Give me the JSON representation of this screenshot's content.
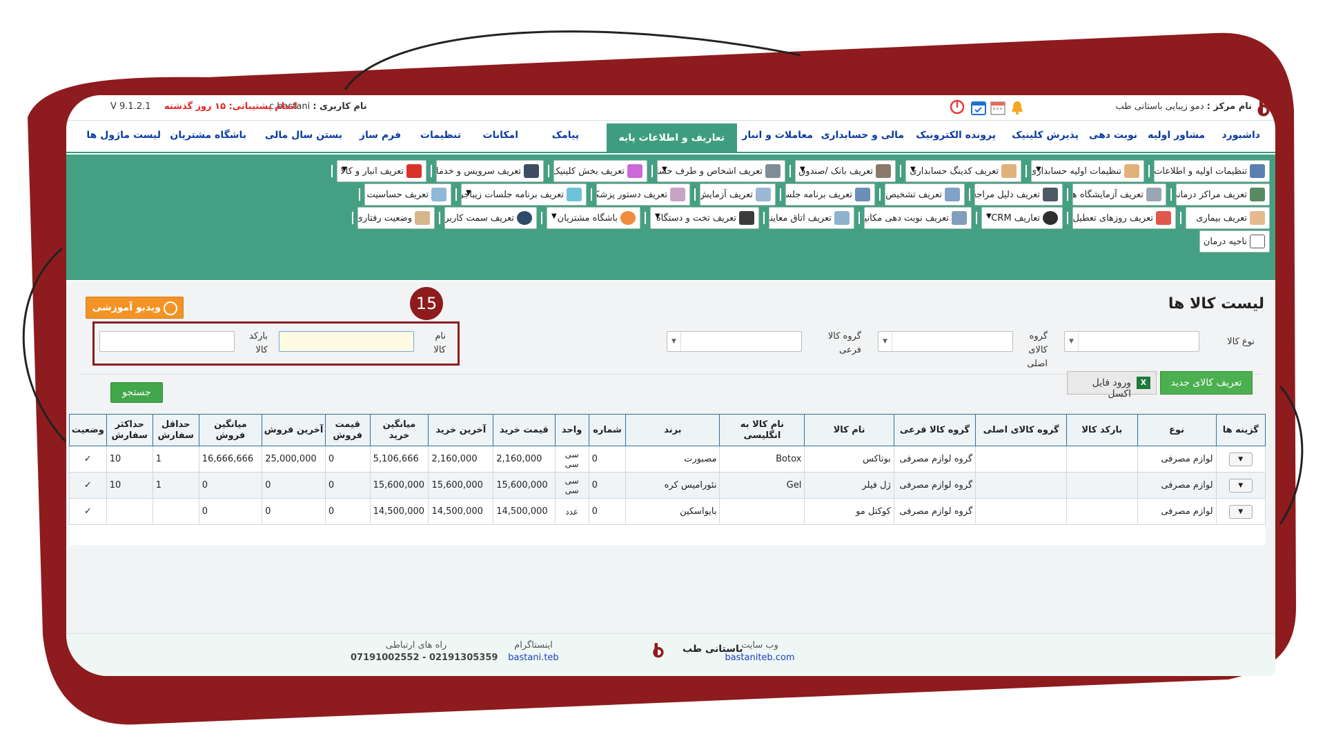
{
  "colors": {
    "frame": "#8e1b1e",
    "green_panel": "#45a083",
    "nav_link": "#0b3aa3",
    "accent_orange": "#f39325",
    "search_green": "#42a64b"
  },
  "topbar": {
    "center_label": "نام مرکز :",
    "center_name": "دمو زیبایی باستانی طب",
    "user_label": "نام کاربری :",
    "user_name": "c.bastani",
    "support": "اتمام پشتیبانی: ۱۵ روز گذشته",
    "version": "V 9.1.2.1",
    "icons": [
      "bell-icon",
      "calendar-icon",
      "calendar-check-icon",
      "power-icon"
    ]
  },
  "nav": {
    "items": [
      "داشبورد",
      "مشاور اولیه",
      "نوبت دهی",
      "پذیرش کلینیک",
      "پرونده الکترونیک",
      "مالی و حسابداری",
      "معاملات و انبار",
      "تعاریف و اطلاعات پایه",
      "پیامک",
      "امکانات",
      "تنظیمات",
      "فرم ساز",
      "بستن سال مالی",
      "باشگاه مشتریان",
      "لیست ماژول ها"
    ],
    "active": "تعاریف و اطلاعات پایه"
  },
  "submenu": {
    "row1": [
      "تنظیمات اولیه و اطلاعات مرکز",
      "تنظیمات اولیه حسابداری",
      "تعریف کدینگ حسابداری",
      "تعریف بانک /صندوق",
      "تعریف اشخاص و طرف حساب",
      "تعریف بخش کلینیک",
      "تعریف سرویس و خدمات",
      "تعریف انبار و کالا"
    ],
    "row2": [
      "تعریف مراکز درمانی",
      "تعریف آزمایشگاه ها",
      "تعریف دلیل مراجعه",
      "تعریف تشخیص",
      "تعریف برنامه جلسات",
      "تعریف آزمایش",
      "تعریف دستور پزشکی",
      "تعریف برنامه جلسات زیباجو",
      "تعریف حساسیت"
    ],
    "row3": [
      "تعریف بیماری",
      "تعریف روزهای تعطیل",
      "تعاریف CRM",
      "تعریف نوبت دهی مکانیزه",
      "تعریف اتاق معاینه",
      "تعریف تخت و دستگاه",
      "باشگاه مشتریان",
      "تعریف سمت کاربر",
      "وضعیت رفتاری"
    ],
    "row4": [
      "ناحیه درمان"
    ]
  },
  "page": {
    "title": "لیست کالا ها",
    "video_button": "ویدیو آموزشی",
    "step_badge": "15",
    "filters": {
      "kala_type_label": "نوع کالا",
      "main_group_label": "گروه کالای اصلی",
      "sub_group_label": "گروه کالا فرعی",
      "kala_name_label": "نام کالا",
      "barcode_label": "بارکد کالا"
    },
    "search_button": "جستجو",
    "new_button": "تعریف کالای جدید",
    "excel_button": "ورود فایل اکسل"
  },
  "table": {
    "headers": [
      "گزینه ها",
      "نوع",
      "بارکد کالا",
      "گروه کالای اصلی",
      "گروه کالا فرعی",
      "نام کالا",
      "نام کالا به انگلیسی",
      "برند",
      "شماره",
      "واحد",
      "قیمت خرید",
      "آخرین خرید",
      "میانگین خرید",
      "قیمت فروش",
      "آخرین فروش",
      "میانگین فروش",
      "حداقل سفارش",
      "حداکثر سفارش",
      "وضعیت"
    ],
    "rows": [
      {
        "type": "لوازم مصرفی",
        "barcode": "",
        "main_group": "",
        "sub_group": "گروه لوازم مصرفی",
        "name": "بوتاکس",
        "name_en": "Botox",
        "brand": "مصبورت",
        "number": "0",
        "unit": "سی سی",
        "buy_price": "2,160,000",
        "last_buy": "2,160,000",
        "avg_buy": "5,106,666",
        "sell_price": "0",
        "last_sell": "25,000,000",
        "avg_sell": "16,666,666",
        "min_order": "1",
        "max_order": "10",
        "status": "✓"
      },
      {
        "type": "لوازم مصرفی",
        "barcode": "",
        "main_group": "",
        "sub_group": "گروه لوازم مصرفی",
        "name": "ژل فیلر",
        "name_en": "Gel",
        "brand": "نئورامیس کره",
        "number": "0",
        "unit": "سی سی",
        "buy_price": "15,600,000",
        "last_buy": "15,600,000",
        "avg_buy": "15,600,000",
        "sell_price": "0",
        "last_sell": "0",
        "avg_sell": "0",
        "min_order": "1",
        "max_order": "10",
        "status": "✓"
      },
      {
        "type": "لوازم مصرفی",
        "barcode": "",
        "main_group": "",
        "sub_group": "گروه لوازم مصرفی",
        "name": "کوکتل مو",
        "name_en": "",
        "brand": "بایواسکین",
        "number": "0",
        "unit": "عدد",
        "buy_price": "14,500,000",
        "last_buy": "14,500,000",
        "avg_buy": "14,500,000",
        "sell_price": "0",
        "last_sell": "0",
        "avg_sell": "0",
        "min_order": "",
        "max_order": "",
        "status": "✓"
      }
    ]
  },
  "footer": {
    "brand": "باستانی طب",
    "website_label": "وب سایت",
    "website": "bastaniteb.com",
    "instagram_label": "اینستاگرام",
    "instagram": "bastani.teb",
    "contact_label": "راه های ارتباطی",
    "phones": "07191002552 - 02191305359"
  }
}
